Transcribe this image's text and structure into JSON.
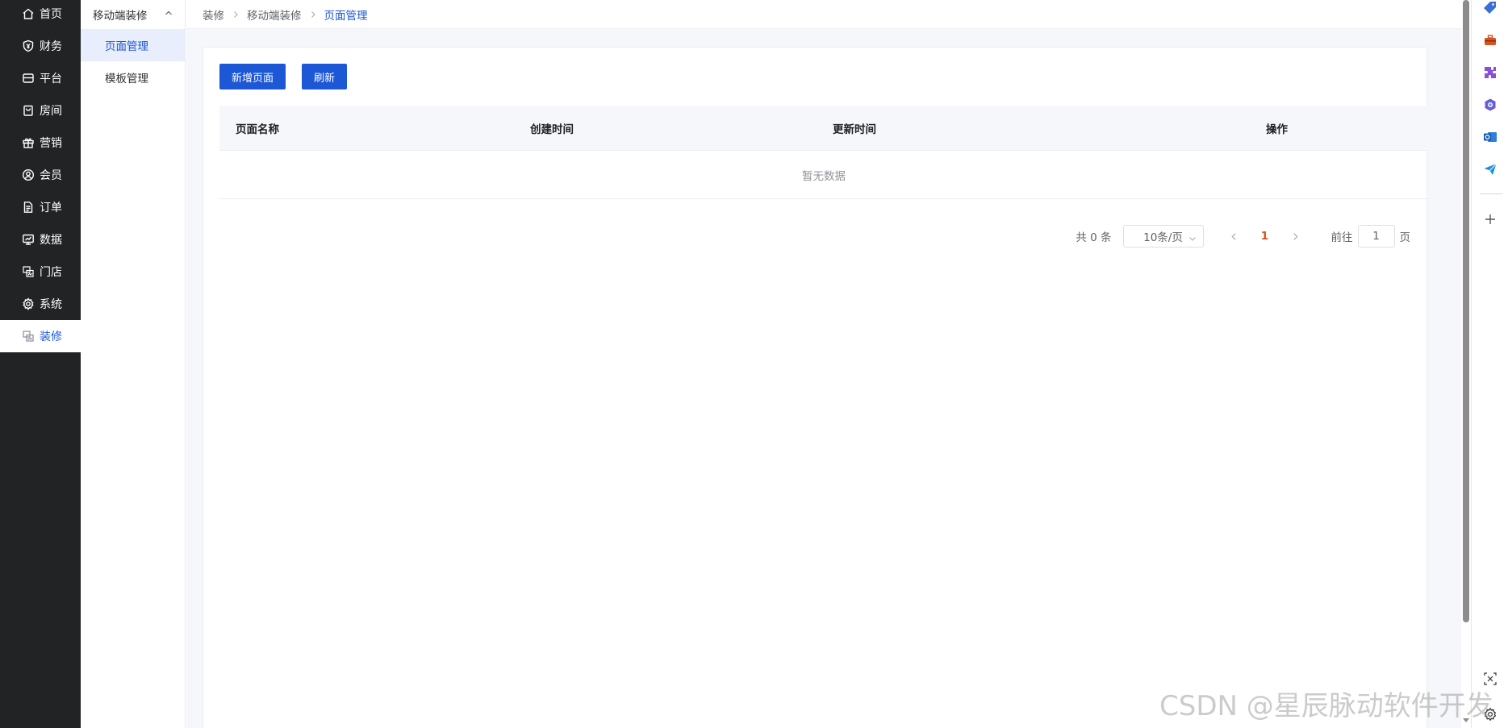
{
  "nav": {
    "items": [
      {
        "label": "首页",
        "icon": "home-icon"
      },
      {
        "label": "财务",
        "icon": "shield-icon"
      },
      {
        "label": "平台",
        "icon": "store-icon"
      },
      {
        "label": "房间",
        "icon": "bag-icon"
      },
      {
        "label": "营销",
        "icon": "gift-icon"
      },
      {
        "label": "会员",
        "icon": "user-icon"
      },
      {
        "label": "订单",
        "icon": "document-icon"
      },
      {
        "label": "数据",
        "icon": "monitor-icon"
      },
      {
        "label": "门店",
        "icon": "images-icon"
      },
      {
        "label": "系统",
        "icon": "gear-icon"
      },
      {
        "label": "装修",
        "icon": "images-icon",
        "active": true
      }
    ]
  },
  "submenu": {
    "group_label": "移动端装修",
    "items": [
      {
        "label": "页面管理",
        "active": true
      },
      {
        "label": "模板管理"
      }
    ]
  },
  "breadcrumb": {
    "items": [
      "装修",
      "移动端装修",
      "页面管理"
    ]
  },
  "toolbar": {
    "add_page_label": "新增页面",
    "refresh_label": "刷新"
  },
  "table": {
    "columns": [
      "页面名称",
      "创建时间",
      "更新时间",
      "操作"
    ],
    "rows": [],
    "empty_text": "暂无数据"
  },
  "pagination": {
    "total_text": "共 0 条",
    "page_size": "10条/页",
    "current_page": "1",
    "goto_prefix": "前往",
    "goto_value": "1",
    "goto_suffix": "页"
  },
  "watermark": "CSDN @星辰脉动软件开发",
  "colors": {
    "nav_bg": "#222324",
    "primary": "#1c57d6",
    "active_sub_bg": "#e8eefb",
    "page_number": "#d9531e"
  }
}
